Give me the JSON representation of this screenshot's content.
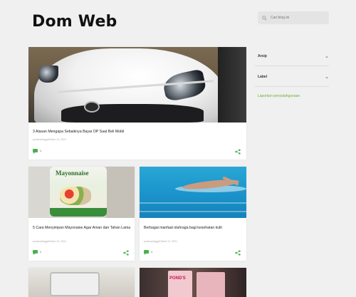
{
  "blog": {
    "title": "Dom Web"
  },
  "search": {
    "placeholder": "Cari blog ini"
  },
  "sidebar": {
    "archive_label": "Arsip",
    "labels_label": "Label",
    "link_text": "Laporkan penyalahgunaan"
  },
  "posts": [
    {
      "title": "3 Alasan Mengapa Sebaiknya Bayar DP Saat Beli Mobil",
      "date": "poskcontegg4Oktob 13, 2021",
      "comments": "4"
    },
    {
      "title": "5 Cara Menyimpan Mayonaise Agar Aman dan Tahan Lama",
      "date": "poskcontegg4Oktob 13, 2021",
      "comments": "4",
      "image_text": "Mayonnaise"
    },
    {
      "title": "Berbagai manfaat olahraga bagi kesehatan kulit",
      "date": "poskcontegg4Oktob 13, 2021",
      "comments": "4"
    },
    {
      "image_text": ""
    },
    {
      "image_text": "POND'S"
    }
  ],
  "colors": {
    "accent": "#4caf50",
    "link": "#6fae3b",
    "background": "#f0f0f0"
  },
  "icons": {
    "search": "search-icon",
    "comment": "comment-icon",
    "share": "share-icon",
    "chevron": "chevron-down-icon"
  }
}
